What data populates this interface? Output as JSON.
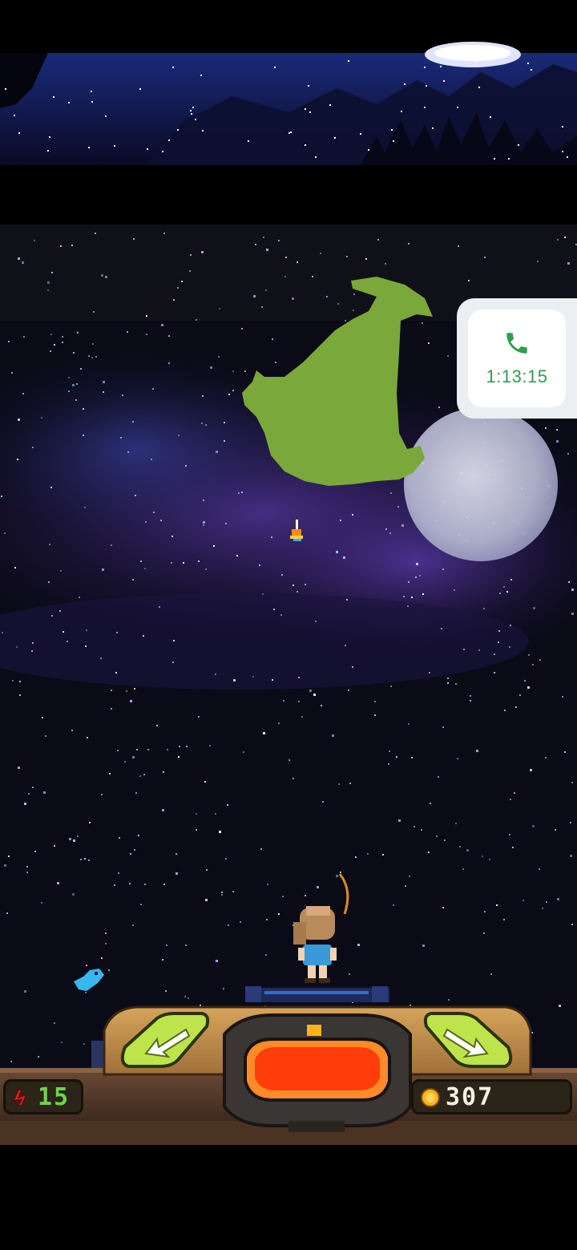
{
  "call_indicator": {
    "icon": "phone-icon",
    "duration": "1:13:15",
    "color": "#2e9e4f"
  },
  "hud": {
    "energy": {
      "icon": "energy-icon",
      "value": "15",
      "color": "#6fd44a"
    },
    "coins": {
      "icon": "coin-icon",
      "value": "307"
    }
  },
  "controls": {
    "left_button": {
      "icon": "arrow-left-icon",
      "color": "#bde44a"
    },
    "right_button": {
      "icon": "arrow-right-icon",
      "color": "#bde44a"
    },
    "cast_button": {
      "color": "#ff3d0a"
    }
  },
  "scene": {
    "creature_color": "#7aa83a",
    "moon_color": "#c8c8dc",
    "sky_color": "#0a0a1a",
    "nebula_color": "#4a2f8a"
  }
}
